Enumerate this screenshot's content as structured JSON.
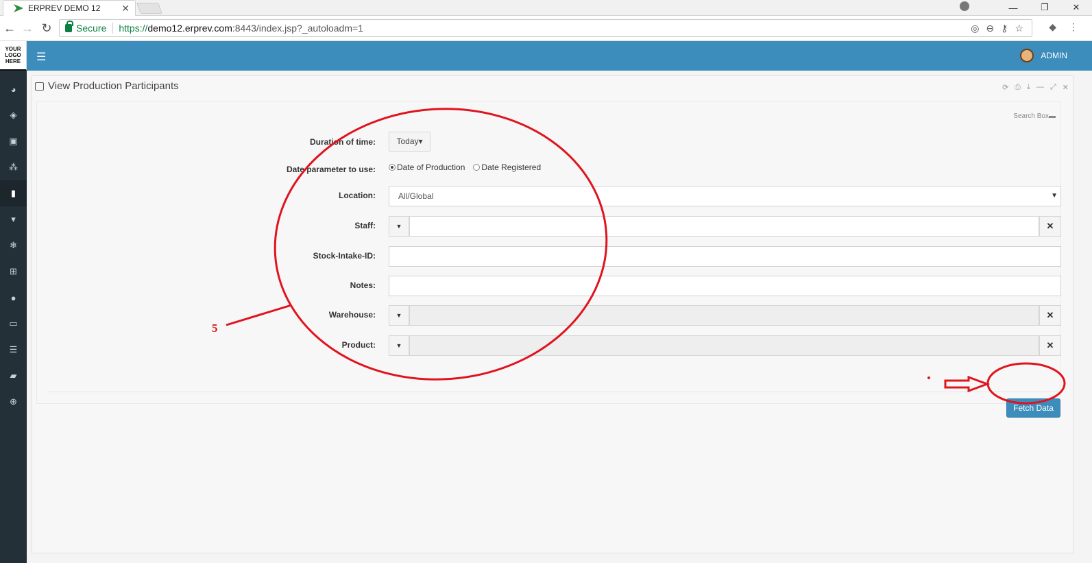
{
  "browser": {
    "tab_title": "ERPREV DEMO 12",
    "secure_label": "Secure",
    "url_scheme": "https://",
    "url_host": "demo12.erprev.com",
    "url_rest": ":8443/index.jsp?_autoloadm=1"
  },
  "app": {
    "logo_lines": [
      "YOUR",
      "LOGO",
      "HERE"
    ],
    "user_name": "ADMIN",
    "sidebar_icons": [
      "dashboard-icon",
      "tag-icon",
      "money-icon",
      "cubes-icon",
      "document-icon",
      "bucket-icon",
      "snowflake-icon",
      "cart-icon",
      "globe-icon",
      "monitor-icon",
      "database-icon",
      "book-icon",
      "lifebuoy-icon"
    ]
  },
  "panel": {
    "title": "View Production Participants",
    "search_box_label": "Search Box"
  },
  "form": {
    "duration_label": "Duration of time:",
    "duration_value": "Today",
    "date_param_label": "Date parameter to use:",
    "date_param_options": [
      "Date of Production",
      "Date Registered"
    ],
    "date_param_selected": "Date of Production",
    "location_label": "Location:",
    "location_value": "All/Global",
    "staff_label": "Staff:",
    "stock_intake_label": "Stock-Intake-ID:",
    "notes_label": "Notes:",
    "warehouse_label": "Warehouse:",
    "product_label": "Product:",
    "fetch_button": "Fetch Data"
  },
  "annotation": {
    "number": "5",
    "color": "#e0141e"
  },
  "colors": {
    "topbar": "#3c8dbc",
    "sidebar": "#233038",
    "button": "#3c8dbc"
  }
}
